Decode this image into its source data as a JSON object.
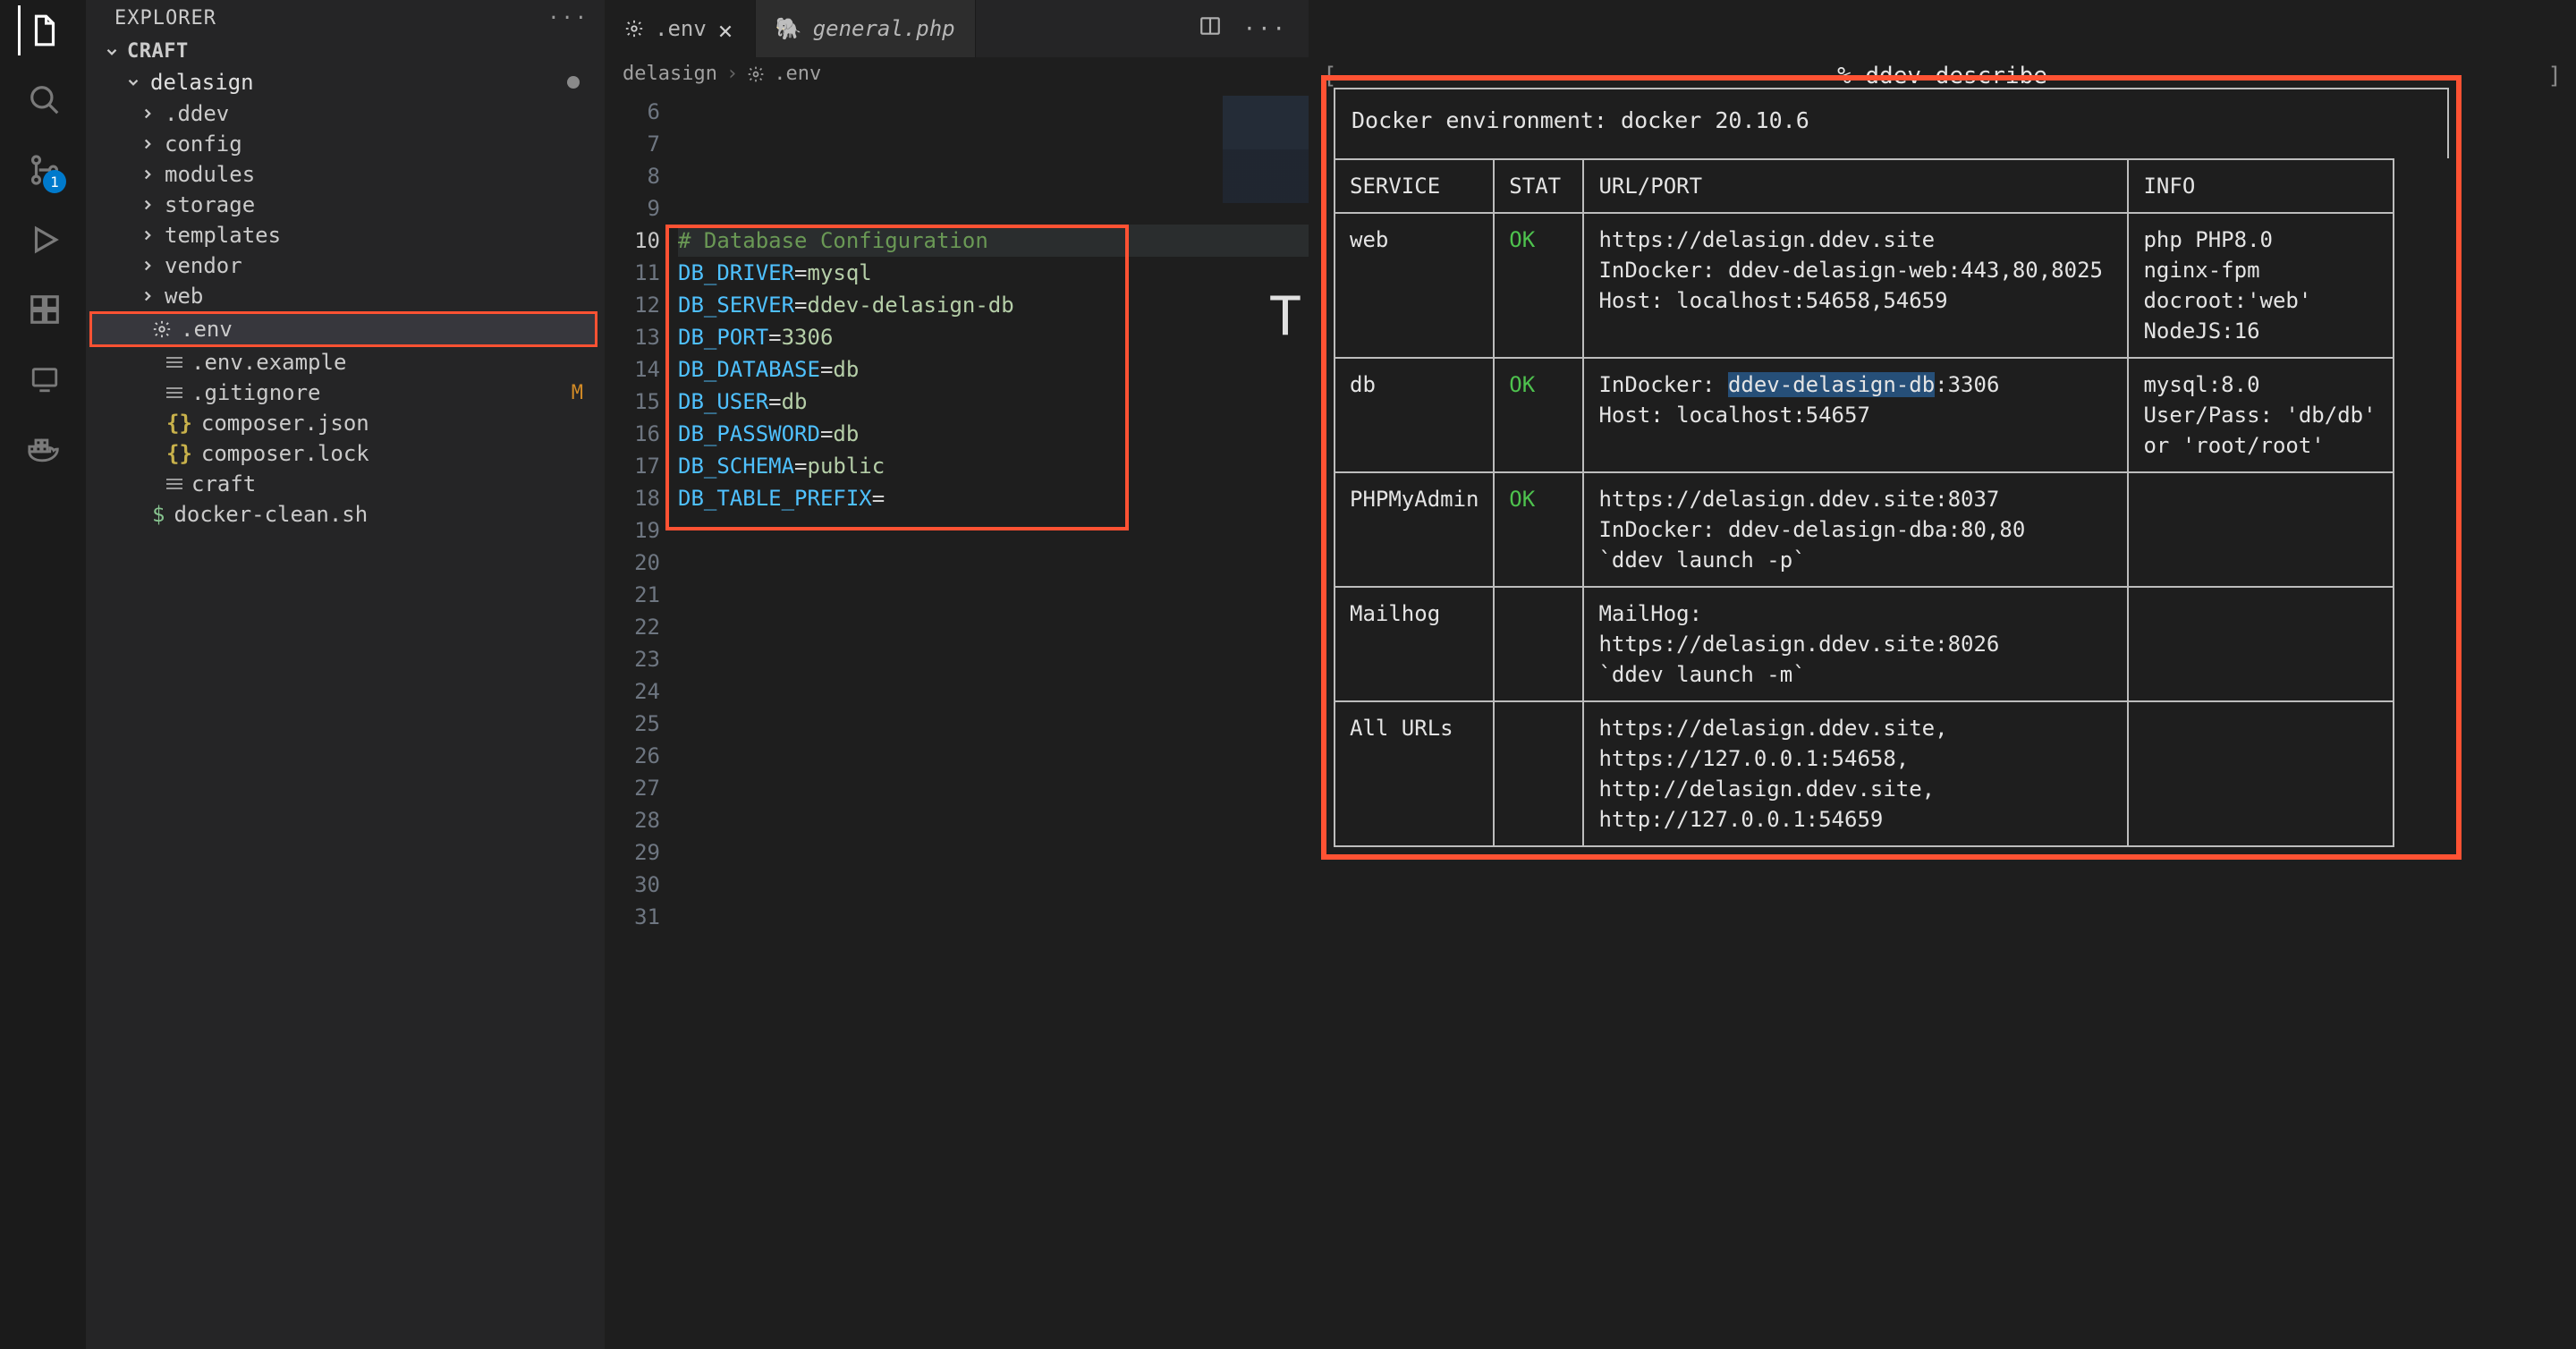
{
  "explorer": {
    "title": "EXPLORER",
    "section": "CRAFT",
    "root": "delasign",
    "items": [
      {
        "label": ".ddev",
        "kind": "folder"
      },
      {
        "label": "config",
        "kind": "folder"
      },
      {
        "label": "modules",
        "kind": "folder"
      },
      {
        "label": "storage",
        "kind": "folder"
      },
      {
        "label": "templates",
        "kind": "folder"
      },
      {
        "label": "vendor",
        "kind": "folder"
      },
      {
        "label": "web",
        "kind": "folder"
      },
      {
        "label": ".env",
        "kind": "gear",
        "selected": true
      },
      {
        "label": ".env.example",
        "kind": "file-lines"
      },
      {
        "label": ".gitignore",
        "kind": "file-lines",
        "tag": "M"
      },
      {
        "label": "composer.json",
        "kind": "json"
      },
      {
        "label": "composer.lock",
        "kind": "json"
      },
      {
        "label": "craft",
        "kind": "file-lines"
      },
      {
        "label": "docker-clean.sh",
        "kind": "dollar"
      }
    ],
    "scm_badge": "1",
    "more": "···"
  },
  "tabs": {
    "active": ".env",
    "other": "general.php",
    "split_tooltip": "Split Editor",
    "more": "···"
  },
  "breadcrumb": {
    "root": "delasign",
    "file": ".env"
  },
  "editor": {
    "gutter_start": 6,
    "gutter_end": 31,
    "current_line": 10,
    "lines": {
      "6": "",
      "7": "",
      "8": "",
      "9": "",
      "10": {
        "full": "# Database Configuration",
        "type": "comment"
      },
      "11": {
        "key": "DB_DRIVER",
        "val": "mysql"
      },
      "12": {
        "key": "DB_SERVER",
        "val": "ddev-delasign-db"
      },
      "13": {
        "key": "DB_PORT",
        "val": "3306"
      },
      "14": {
        "key": "DB_DATABASE",
        "val": "db"
      },
      "15": {
        "key": "DB_USER",
        "val": "db"
      },
      "16": {
        "key": "DB_PASSWORD",
        "val": "db"
      },
      "17": {
        "key": "DB_SCHEMA",
        "val": "public"
      },
      "18": {
        "key": "DB_TABLE_PREFIX",
        "val": ""
      }
    }
  },
  "terminal": {
    "prompt": "% ddev describe",
    "docker_env": "Docker environment: docker 20.10.6",
    "headers": {
      "service": "SERVICE",
      "stat": "STAT",
      "url": "URL/PORT",
      "info": "INFO"
    },
    "rows": [
      {
        "service": "web",
        "stat": "OK",
        "url": "https://delasign.ddev.site\nInDocker: ddev-delasign-web:443,80,8025\nHost: localhost:54658,54659",
        "info": "php PHP8.0\nnginx-fpm\ndocroot:'web'\nNodeJS:16"
      },
      {
        "service": "db",
        "stat": "OK",
        "url_prefix": "InDocker: ",
        "url_sel": "ddev-delasign-db",
        "url_after": ":3306\nHost: localhost:54657",
        "info": "mysql:8.0\nUser/Pass: 'db/db'\nor 'root/root'"
      },
      {
        "service": "PHPMyAdmin",
        "stat": "OK",
        "url": "https://delasign.ddev.site:8037\nInDocker: ddev-delasign-dba:80,80\n`ddev launch -p`",
        "info": ""
      },
      {
        "service": "Mailhog",
        "stat": "",
        "url": "MailHog: https://delasign.ddev.site:8026\n`ddev launch -m`",
        "info": ""
      },
      {
        "service": "All URLs",
        "stat": "",
        "url": "https://delasign.ddev.site,\nhttps://127.0.0.1:54658,\nhttp://delasign.ddev.site,\nhttp://127.0.0.1:54659",
        "info": ""
      }
    ],
    "bracket_left": "[",
    "bracket_right": "]",
    "big_T": "T"
  }
}
